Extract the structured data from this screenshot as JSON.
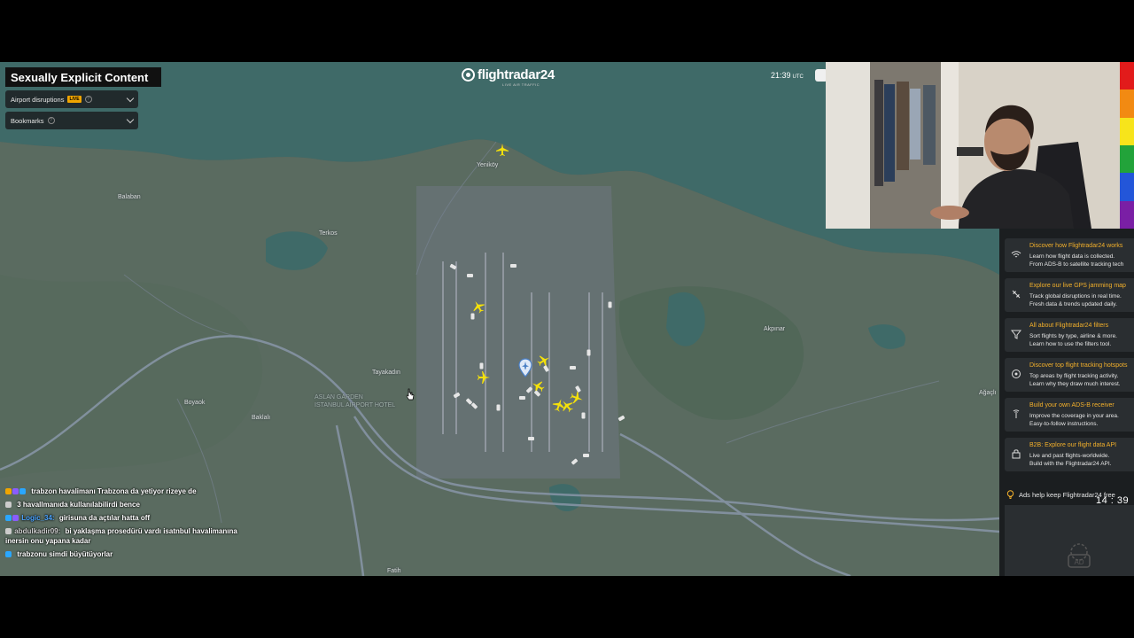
{
  "overlay": {
    "warning": "Sexually Explicit Content"
  },
  "fr24": {
    "logo_text": "flightradar24",
    "logo_sub": "LIVE AIR TRAFFIC",
    "time": "21:39",
    "time_zone": "UTC"
  },
  "panels": {
    "airport_disruptions": "Airport disruptions",
    "live_badge": "LIVE",
    "bookmarks": "Bookmarks"
  },
  "map": {
    "places": [
      "Yeniköy",
      "Balaban",
      "Terkos",
      "Tayakadın",
      "Boyaok",
      "Baklalı",
      "Akpınar",
      "Ağaçlı",
      "Fatih",
      "ISTANBUL AIRPORT HOTEL"
    ],
    "airport_label": "ASLAN GARDEN"
  },
  "chat": [
    {
      "user": "",
      "user_color": "#ff3b3b",
      "message": "trabzon havalimanı Trabzona da yetiyor rizeye de",
      "badges": [
        "#f0a500",
        "#8a5cff",
        "#2aa7ff"
      ]
    },
    {
      "user": "",
      "user_color": "#5ab0ff",
      "message": "3 havallmanıda kullanılabilirdi bence",
      "badges": [
        "#cccccc"
      ]
    },
    {
      "user": "Logic_34:",
      "user_color": "#4aa3ff",
      "message": "girisuna da açtılar hatta off",
      "badges": [
        "#2aa7ff",
        "#8a5cff"
      ]
    },
    {
      "user": "abdulkadir09:",
      "user_color": "#d0d0d0",
      "message": "bi yaklaşma prosedürü vardı isatnbul havalimanına inersin onu yapana kadar",
      "badges": [
        "#cccccc"
      ]
    },
    {
      "user": "",
      "user_color": "#ff3b3b",
      "message": "trabzonu simdi büyütüyorlar",
      "badges": [
        "#2aa7ff"
      ]
    }
  ],
  "sidebar": {
    "cards": [
      {
        "icon": "wifi-icon",
        "title": "Discover how Flightradar24 works",
        "line1": "Learn how flight data is collected.",
        "line2": "From ADS-B to satellite tracking tech"
      },
      {
        "icon": "gps-jamming-icon",
        "title": "Explore our live GPS jamming map",
        "line1": "Track global disruptions in real time.",
        "line2": "Fresh data & trends updated daily."
      },
      {
        "icon": "filter-icon",
        "title": "All about Flightradar24 filters",
        "line1": "Sort flights by type, airline & more.",
        "line2": "Learn how to use the filters tool."
      },
      {
        "icon": "hotspot-icon",
        "title": "Discover top flight tracking hotspots",
        "line1": "Top areas by flight tracking activity.",
        "line2": "Learn why they draw much interest."
      },
      {
        "icon": "receiver-icon",
        "title": "Build your own ADS-B receiver",
        "line1": "Improve the coverage in your area.",
        "line2": "Easy-to-follow instructions."
      },
      {
        "icon": "api-icon",
        "title": "B2B: Explore our flight data API",
        "line1": "Live and past flights-worldwide.",
        "line2": "Build with the Flightradar24 API."
      }
    ],
    "ads_note": "Ads help keep Flightradar24 free",
    "ad_label": "AD"
  },
  "stream": {
    "elapsed": "14 : 39"
  },
  "colors": {
    "aircraft": "#f5e10a",
    "card_title": "#f3b02b",
    "live_badge": "#f0a500"
  }
}
